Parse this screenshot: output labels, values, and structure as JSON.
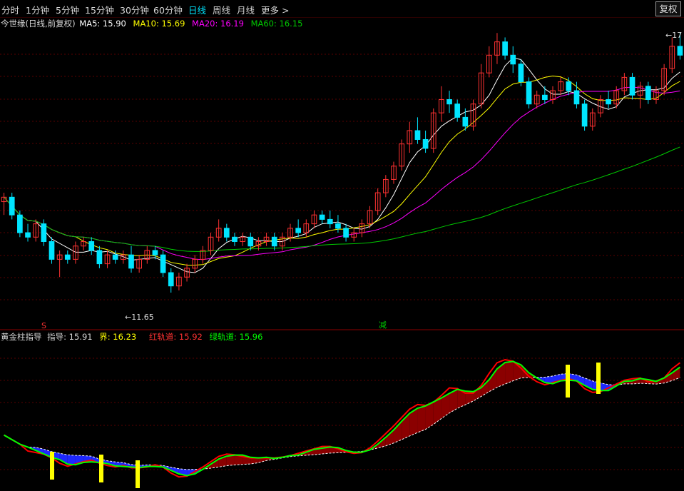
{
  "toolbar": {
    "tabs": [
      {
        "label": "分时",
        "active": false
      },
      {
        "label": "1分钟",
        "active": false
      },
      {
        "label": "5分钟",
        "active": false
      },
      {
        "label": "15分钟",
        "active": false
      },
      {
        "label": "30分钟",
        "active": false
      },
      {
        "label": "60分钟",
        "active": false
      },
      {
        "label": "日线",
        "active": true
      },
      {
        "label": "周线",
        "active": false
      },
      {
        "label": "月线",
        "active": false
      },
      {
        "label": "更多 >",
        "active": false
      }
    ],
    "fuquan_label": "复权"
  },
  "main_legend": {
    "title": "今世缘(日线,前复权)",
    "ma5": "MA5: 15.90",
    "ma10": "MA10: 15.69",
    "ma20": "MA20: 16.19",
    "ma60": "MA60: 16.15"
  },
  "sub_legend": {
    "title": "黄金柱指导",
    "guide": "指导: 15.91",
    "bound": "界: 16.23",
    "red_track": "红轨道: 15.92",
    "green_track": "绿轨道: 15.96"
  },
  "annotations": {
    "low_price": "←11.65",
    "high_price": "←17",
    "s_marker": "S",
    "jian_marker": "减"
  },
  "colors": {
    "up": "#ff3232",
    "down": "#00e5ff",
    "ma5": "#ffffff",
    "ma10": "#ffff00",
    "ma20": "#ff00ff",
    "ma60": "#00c800",
    "red_line": "#ff0000",
    "green_line": "#00ff00",
    "fill_red": "#8b0000",
    "fill_blue": "#1e28ff",
    "yellow_bar": "#ffff00",
    "grid": "#5a0000"
  },
  "chart_data": {
    "type": "candlestick",
    "price_range": [
      11.2,
      17.6
    ],
    "candles": [
      [
        13.7,
        13.9,
        13.4,
        13.8
      ],
      [
        13.8,
        13.9,
        13.3,
        13.4
      ],
      [
        13.4,
        13.5,
        12.9,
        13.0
      ],
      [
        13.0,
        13.2,
        12.8,
        12.9
      ],
      [
        12.9,
        13.3,
        12.8,
        13.2
      ],
      [
        13.2,
        13.3,
        12.7,
        12.8
      ],
      [
        12.8,
        12.9,
        12.3,
        12.4
      ],
      [
        12.4,
        12.6,
        12.0,
        12.5
      ],
      [
        12.5,
        12.6,
        12.3,
        12.4
      ],
      [
        12.4,
        12.8,
        12.3,
        12.7
      ],
      [
        12.7,
        12.9,
        12.6,
        12.8
      ],
      [
        12.8,
        12.9,
        12.5,
        12.6
      ],
      [
        12.6,
        12.7,
        12.2,
        12.3
      ],
      [
        12.3,
        12.6,
        12.2,
        12.5
      ],
      [
        12.5,
        12.6,
        12.3,
        12.4
      ],
      [
        12.4,
        12.6,
        12.3,
        12.5
      ],
      [
        12.5,
        12.7,
        12.1,
        12.2
      ],
      [
        12.2,
        12.5,
        12.1,
        12.4
      ],
      [
        12.4,
        12.7,
        12.3,
        12.6
      ],
      [
        12.6,
        12.7,
        12.4,
        12.5
      ],
      [
        12.5,
        12.6,
        12.0,
        12.1
      ],
      [
        12.1,
        12.2,
        11.65,
        11.8
      ],
      [
        11.8,
        12.1,
        11.7,
        12.0
      ],
      [
        12.0,
        12.3,
        11.9,
        12.2
      ],
      [
        12.2,
        12.5,
        12.1,
        12.4
      ],
      [
        12.4,
        12.7,
        12.3,
        12.6
      ],
      [
        12.6,
        13.0,
        12.5,
        12.9
      ],
      [
        12.9,
        13.3,
        12.8,
        13.1
      ],
      [
        13.1,
        13.2,
        12.8,
        12.9
      ],
      [
        12.9,
        13.0,
        12.7,
        12.8
      ],
      [
        12.8,
        13.0,
        12.7,
        12.9
      ],
      [
        12.9,
        13.0,
        12.6,
        12.7
      ],
      [
        12.7,
        12.9,
        12.6,
        12.8
      ],
      [
        12.8,
        13.0,
        12.7,
        12.9
      ],
      [
        12.9,
        13.0,
        12.6,
        12.7
      ],
      [
        12.7,
        13.0,
        12.6,
        12.9
      ],
      [
        12.9,
        13.2,
        12.8,
        13.1
      ],
      [
        13.1,
        13.3,
        12.9,
        13.0
      ],
      [
        13.0,
        13.3,
        12.9,
        13.2
      ],
      [
        13.2,
        13.5,
        13.1,
        13.4
      ],
      [
        13.4,
        13.5,
        13.2,
        13.3
      ],
      [
        13.3,
        13.5,
        13.1,
        13.2
      ],
      [
        13.2,
        13.4,
        13.0,
        13.1
      ],
      [
        13.1,
        13.2,
        12.8,
        12.9
      ],
      [
        12.9,
        13.1,
        12.8,
        13.0
      ],
      [
        13.0,
        13.3,
        12.9,
        13.2
      ],
      [
        13.2,
        13.6,
        13.1,
        13.5
      ],
      [
        13.5,
        14.0,
        13.4,
        13.9
      ],
      [
        13.9,
        14.3,
        13.8,
        14.2
      ],
      [
        14.2,
        14.6,
        14.1,
        14.5
      ],
      [
        14.5,
        15.1,
        14.4,
        15.0
      ],
      [
        15.0,
        15.5,
        14.8,
        15.3
      ],
      [
        15.3,
        15.6,
        15.0,
        15.1
      ],
      [
        15.1,
        15.3,
        14.8,
        14.9
      ],
      [
        14.9,
        15.8,
        14.8,
        15.7
      ],
      [
        15.7,
        16.3,
        15.5,
        16.0
      ],
      [
        16.0,
        16.2,
        15.7,
        15.9
      ],
      [
        15.9,
        16.0,
        15.5,
        15.6
      ],
      [
        15.6,
        15.8,
        15.3,
        15.4
      ],
      [
        15.4,
        16.0,
        15.3,
        15.9
      ],
      [
        15.9,
        16.8,
        15.8,
        16.6
      ],
      [
        16.6,
        17.2,
        16.5,
        17.0
      ],
      [
        17.0,
        17.5,
        16.8,
        17.3
      ],
      [
        17.3,
        17.4,
        16.9,
        17.0
      ],
      [
        17.0,
        17.2,
        16.6,
        16.8
      ],
      [
        16.8,
        16.9,
        16.3,
        16.4
      ],
      [
        16.4,
        16.5,
        15.8,
        15.9
      ],
      [
        15.9,
        16.2,
        15.8,
        16.1
      ],
      [
        16.1,
        16.3,
        15.9,
        16.0
      ],
      [
        16.0,
        16.3,
        15.9,
        16.2
      ],
      [
        16.2,
        16.5,
        16.1,
        16.4
      ],
      [
        16.4,
        16.5,
        16.1,
        16.2
      ],
      [
        16.2,
        16.4,
        15.8,
        15.9
      ],
      [
        15.9,
        16.0,
        15.3,
        15.4
      ],
      [
        15.4,
        15.8,
        15.3,
        15.7
      ],
      [
        15.7,
        16.1,
        15.6,
        16.0
      ],
      [
        16.0,
        16.2,
        15.8,
        15.9
      ],
      [
        15.9,
        16.3,
        15.8,
        16.2
      ],
      [
        16.2,
        16.6,
        16.1,
        16.5
      ],
      [
        16.5,
        16.6,
        16.0,
        16.1
      ],
      [
        16.1,
        16.4,
        15.8,
        16.3
      ],
      [
        16.3,
        16.4,
        15.9,
        16.0
      ],
      [
        16.0,
        16.3,
        15.9,
        16.2
      ],
      [
        16.2,
        16.8,
        16.1,
        16.7
      ],
      [
        16.7,
        17.4,
        16.6,
        17.2
      ],
      [
        17.2,
        17.5,
        16.9,
        17.0
      ]
    ],
    "sub_range": [
      0,
      100
    ]
  }
}
